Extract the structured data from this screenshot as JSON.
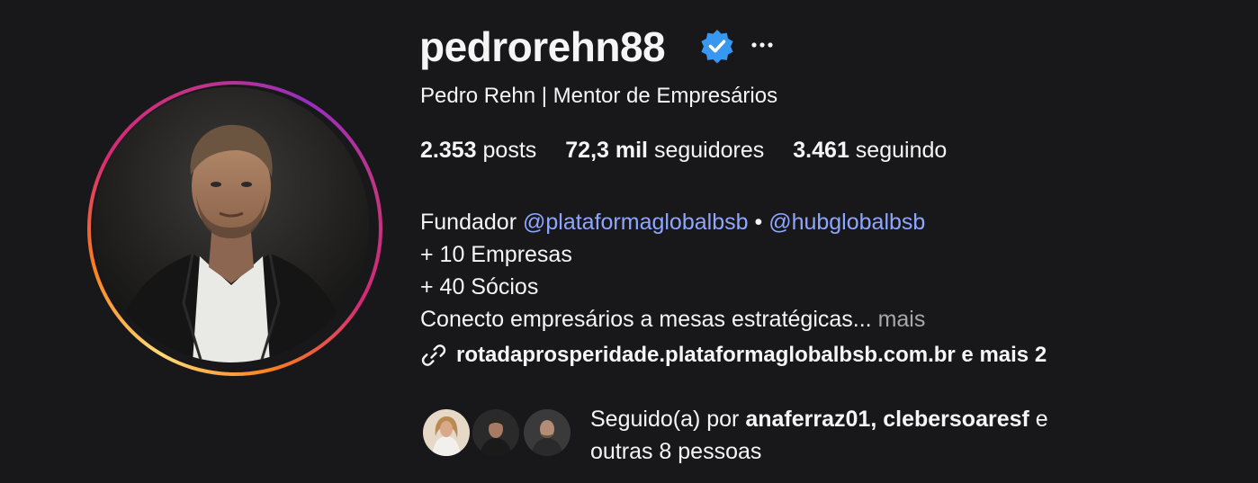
{
  "profile": {
    "username": "pedrorehn88",
    "full_name": "Pedro Rehn | Mentor de Empresários",
    "verified_icon": "verified-badge-icon",
    "more_icon": "more-options-icon"
  },
  "stats": {
    "posts_count": "2.353",
    "posts_label": "posts",
    "followers_count": "72,3 mil",
    "followers_label": "seguidores",
    "following_count": "3.461",
    "following_label": "seguindo"
  },
  "bio": {
    "line1_prefix": "Fundador",
    "mention1": "@plataformaglobalbsb",
    "separator": "•",
    "mention2": "@hubglobalbsb",
    "line2": "+ 10 Empresas",
    "line3": "+ 40 Sócios",
    "line4": "Conecto empresários a mesas estratégicas...",
    "more_label": "mais"
  },
  "link": {
    "icon": "link-icon",
    "text": "rotadaprosperidade.plataformaglobalbsb.com.br e mais 2"
  },
  "followed_by": {
    "prefix": "Seguido(a) por",
    "user1": "anaferraz01",
    "comma": ",",
    "user2": "clebersoaresf",
    "conj": "e",
    "suffix": "outras 8 pessoas"
  },
  "colors": {
    "background": "#18181b",
    "text": "#f5f5f5",
    "mention": "#8ea6ff",
    "muted": "#a8a8a8",
    "verified": "#3897f0"
  }
}
